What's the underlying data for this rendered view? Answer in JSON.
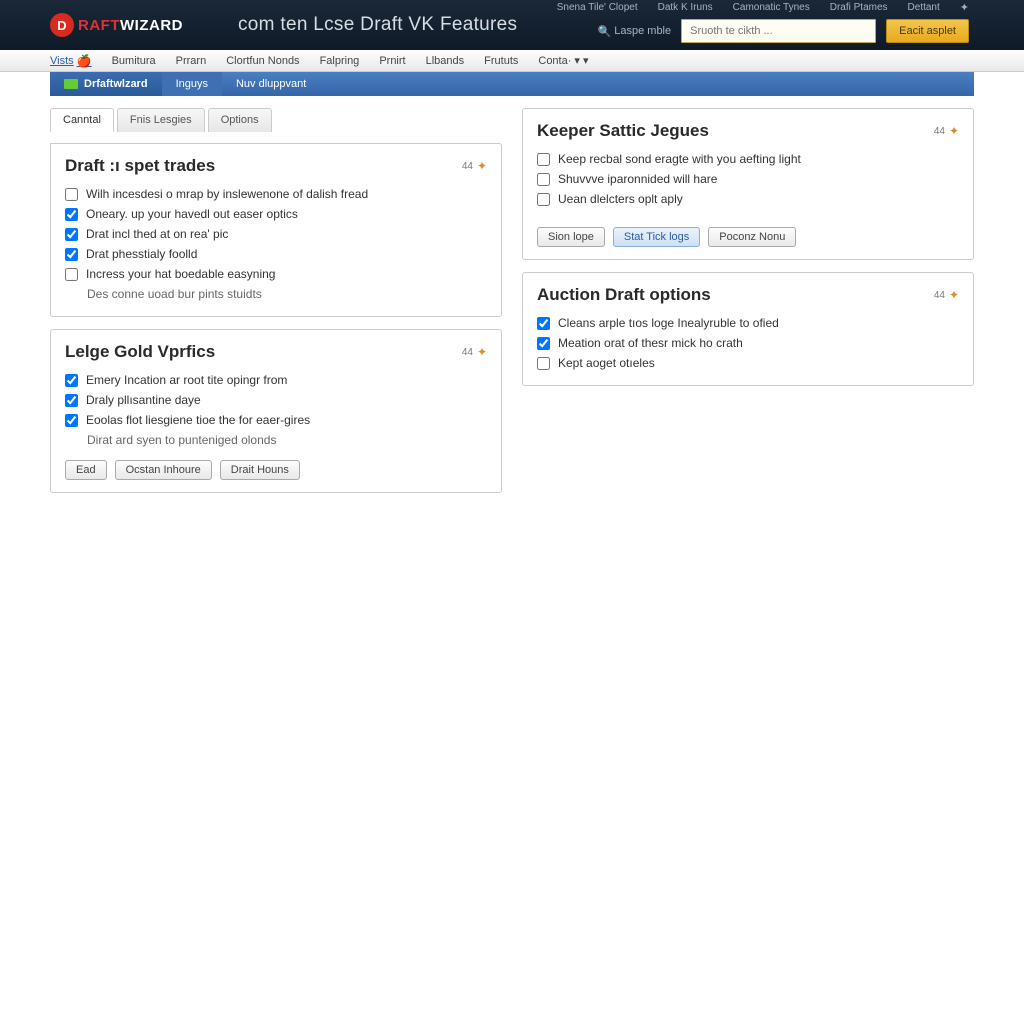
{
  "header": {
    "logo_letter": "D",
    "logo_part1": "RAFT",
    "logo_part2": "WIZARD",
    "title": "com ten Lcse Draft VK Features",
    "topnav": [
      "Snena Tile' Clopet",
      "Datk K Iruns",
      "Camonatic Tynes",
      "Drafi Ptames",
      "Dettant"
    ],
    "search_label": "Laspe mble",
    "search_placeholder": "Sruoth te cikth ...",
    "cta": "Eacit asplet"
  },
  "nav": {
    "items": [
      "Vists",
      "Bumitura",
      "Prrarn",
      "Clortfun Nonds",
      "Falpring",
      "Prnirt",
      "Llbands",
      "Frututs",
      "Conta·"
    ],
    "caret": "▾"
  },
  "subnav": {
    "items": [
      "Drfaftwlzard",
      "Inguys",
      "Nuv dluppvant"
    ]
  },
  "tabs": [
    "Canntal",
    "Fnis Lesgies",
    "Options"
  ],
  "left": {
    "panel1": {
      "title": "Draft :ı spet trades",
      "badge": "44",
      "opts": [
        {
          "checked": false,
          "label": "Wilh incesdesi o mrap by inslewenone of dalish fread"
        },
        {
          "checked": true,
          "label": "Oneary. up your havedl out easer optics"
        },
        {
          "checked": true,
          "label": "Drat incl thed at on rea' pic"
        },
        {
          "checked": true,
          "label": "Drat phesstialy foolld"
        },
        {
          "checked": false,
          "label": "Incress your hat boedable easyning"
        }
      ],
      "sub": "Des conne uoad bur pints stuidts"
    },
    "panel2": {
      "title": "Lelge Gold Vprfics",
      "badge": "44",
      "opts": [
        {
          "checked": true,
          "label": "Emery Incation ar root tite opingr from"
        },
        {
          "checked": true,
          "label": "Draly pllısantine daye"
        },
        {
          "checked": true,
          "label": "Eoolas flot liesgiene tioe the for eaer-gires"
        }
      ],
      "sub": "Dirat ard syen to punteniged olonds",
      "buttons": [
        "Ead",
        "Ocstan Inhoure",
        "Drait Houns"
      ]
    }
  },
  "right": {
    "panel1": {
      "title": "Keeper Sattic Jegues",
      "badge": "44",
      "opts": [
        {
          "checked": false,
          "label": "Keep recbal sond eragte with you aefting light"
        },
        {
          "checked": false,
          "label": "Shuvvve iparonnided will hare"
        },
        {
          "checked": false,
          "label": "Uean dlelcters oplt aply"
        }
      ],
      "buttons": [
        "Sion lope",
        "Stat Tick logs",
        "Poconz Nonu"
      ]
    },
    "panel2": {
      "title": "Auction Draft options",
      "badge": "44",
      "opts": [
        {
          "checked": true,
          "label": "Cleans arple tıos loge Inealyruble to ofied"
        },
        {
          "checked": true,
          "label": "Meation orat of thesr mick ho crath"
        },
        {
          "checked": false,
          "label": "Kept aoget otıeles"
        }
      ]
    }
  }
}
